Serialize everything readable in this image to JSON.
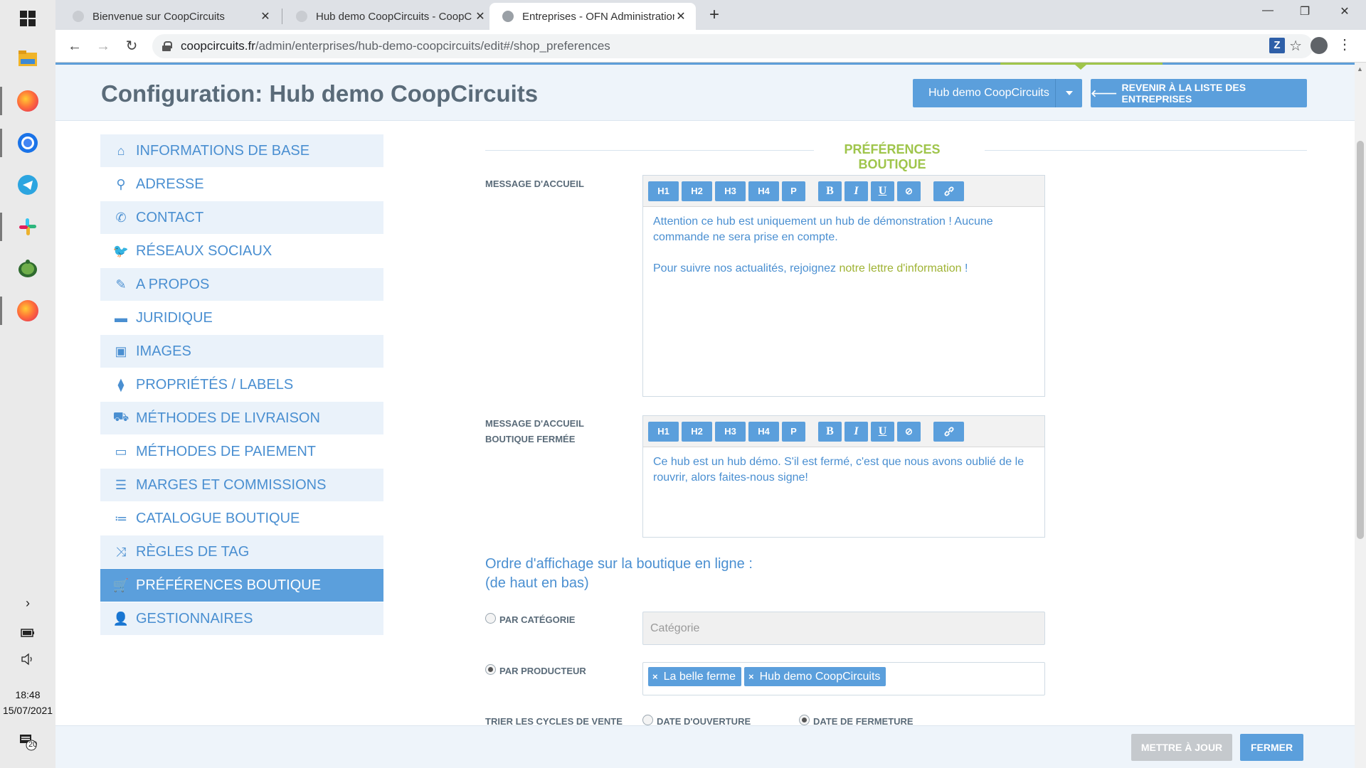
{
  "taskbar": {
    "apps": [
      "windows-start",
      "file-explorer",
      "firefox",
      "chrome",
      "telegram",
      "slack",
      "turtle-app",
      "firefox-2"
    ],
    "time": "18:48",
    "date": "15/07/2021",
    "notifications": "20",
    "expand_icon": "chevron-right-icon",
    "battery_icon": "battery-icon",
    "volume_icon": "volume-icon"
  },
  "browser": {
    "tabs": [
      {
        "title": "Bienvenue sur CoopCircuits",
        "active": false
      },
      {
        "title": "Hub demo CoopCircuits - CoopC",
        "active": false
      },
      {
        "title": "Entreprises - OFN Administration",
        "active": true
      }
    ],
    "url_host": "coopcircuits.fr",
    "url_path": "/admin/enterprises/hub-demo-coopcircuits/edit#/shop_preferences",
    "extension_label": "Z"
  },
  "header": {
    "title": "Configuration: Hub demo CoopCircuits",
    "hub_select": "Hub demo CoopCircuits",
    "back_button": "REVENIR À LA LISTE DES ENTREPRISES"
  },
  "sidebar": {
    "items": [
      {
        "label": "INFORMATIONS DE BASE",
        "icon": "home-icon"
      },
      {
        "label": "ADRESSE",
        "icon": "map-marker-icon"
      },
      {
        "label": "CONTACT",
        "icon": "phone-icon"
      },
      {
        "label": "RÉSEAUX SOCIAUX",
        "icon": "twitter-icon"
      },
      {
        "label": "A PROPOS",
        "icon": "pencil-icon"
      },
      {
        "label": "JURIDIQUE",
        "icon": "briefcase-icon"
      },
      {
        "label": "IMAGES",
        "icon": "image-icon"
      },
      {
        "label": "PROPRIÉTÉS / LABELS",
        "icon": "tags-icon"
      },
      {
        "label": "MÉTHODES DE LIVRAISON",
        "icon": "truck-icon"
      },
      {
        "label": "MÉTHODES DE PAIEMENT",
        "icon": "money-icon"
      },
      {
        "label": "MARGES ET COMMISSIONS",
        "icon": "credit-card-icon"
      },
      {
        "label": "CATALOGUE BOUTIQUE",
        "icon": "list-icon"
      },
      {
        "label": "RÈGLES DE TAG",
        "icon": "random-icon"
      },
      {
        "label": "PRÉFÉRENCES BOUTIQUE",
        "icon": "cart-icon",
        "active": true
      },
      {
        "label": "GESTIONNAIRES",
        "icon": "user-icon"
      }
    ]
  },
  "main": {
    "section_title": "PRÉFÉRENCES BOUTIQUE",
    "welcome_label": "MESSAGE D'ACCUEIL",
    "closed_label_1": "MESSAGE D'ACCUEIL",
    "closed_label_2": "BOUTIQUE FERMÉE",
    "toolbar": [
      "H1",
      "H2",
      "H3",
      "H4",
      "P",
      "B",
      "I",
      "U",
      "⊘"
    ],
    "welcome_text_1": "Attention ce hub est uniquement un hub de démonstration ! Aucune commande ne sera prise en compte.",
    "welcome_text_2_prefix": "Pour suivre nos actualités, rejoignez ",
    "welcome_text_2_link": "notre lettre d'information",
    "welcome_text_2_suffix": " !",
    "closed_text": "Ce hub est un hub démo. S'il est fermé, c'est que nous avons oublié de le rouvrir, alors faites-nous signe!",
    "order_title_1": "Ordre d'affichage sur la boutique en ligne :",
    "order_title_2": "(de haut en bas)",
    "radio_category": "PAR CATÉGORIE",
    "radio_producer": "PAR PRODUCTEUR",
    "category_placeholder": "Catégorie",
    "producer_tags": [
      "La belle ferme",
      "Hub demo CoopCircuits"
    ],
    "sort_cycles_label": "TRIER LES CYCLES DE VENTE",
    "sort_open": "DATE D'OUVERTURE",
    "sort_close": "DATE DE FERMETURE",
    "selected_order": "PAR PRODUCTEUR",
    "selected_sort": "DATE DE FERMETURE"
  },
  "footer": {
    "update_button": "METTRE À JOUR",
    "close_button": "FERMER"
  },
  "colors": {
    "primary": "#5b9fdc",
    "accent_green": "#9fc54b",
    "text_blue": "#4a8fd1"
  }
}
